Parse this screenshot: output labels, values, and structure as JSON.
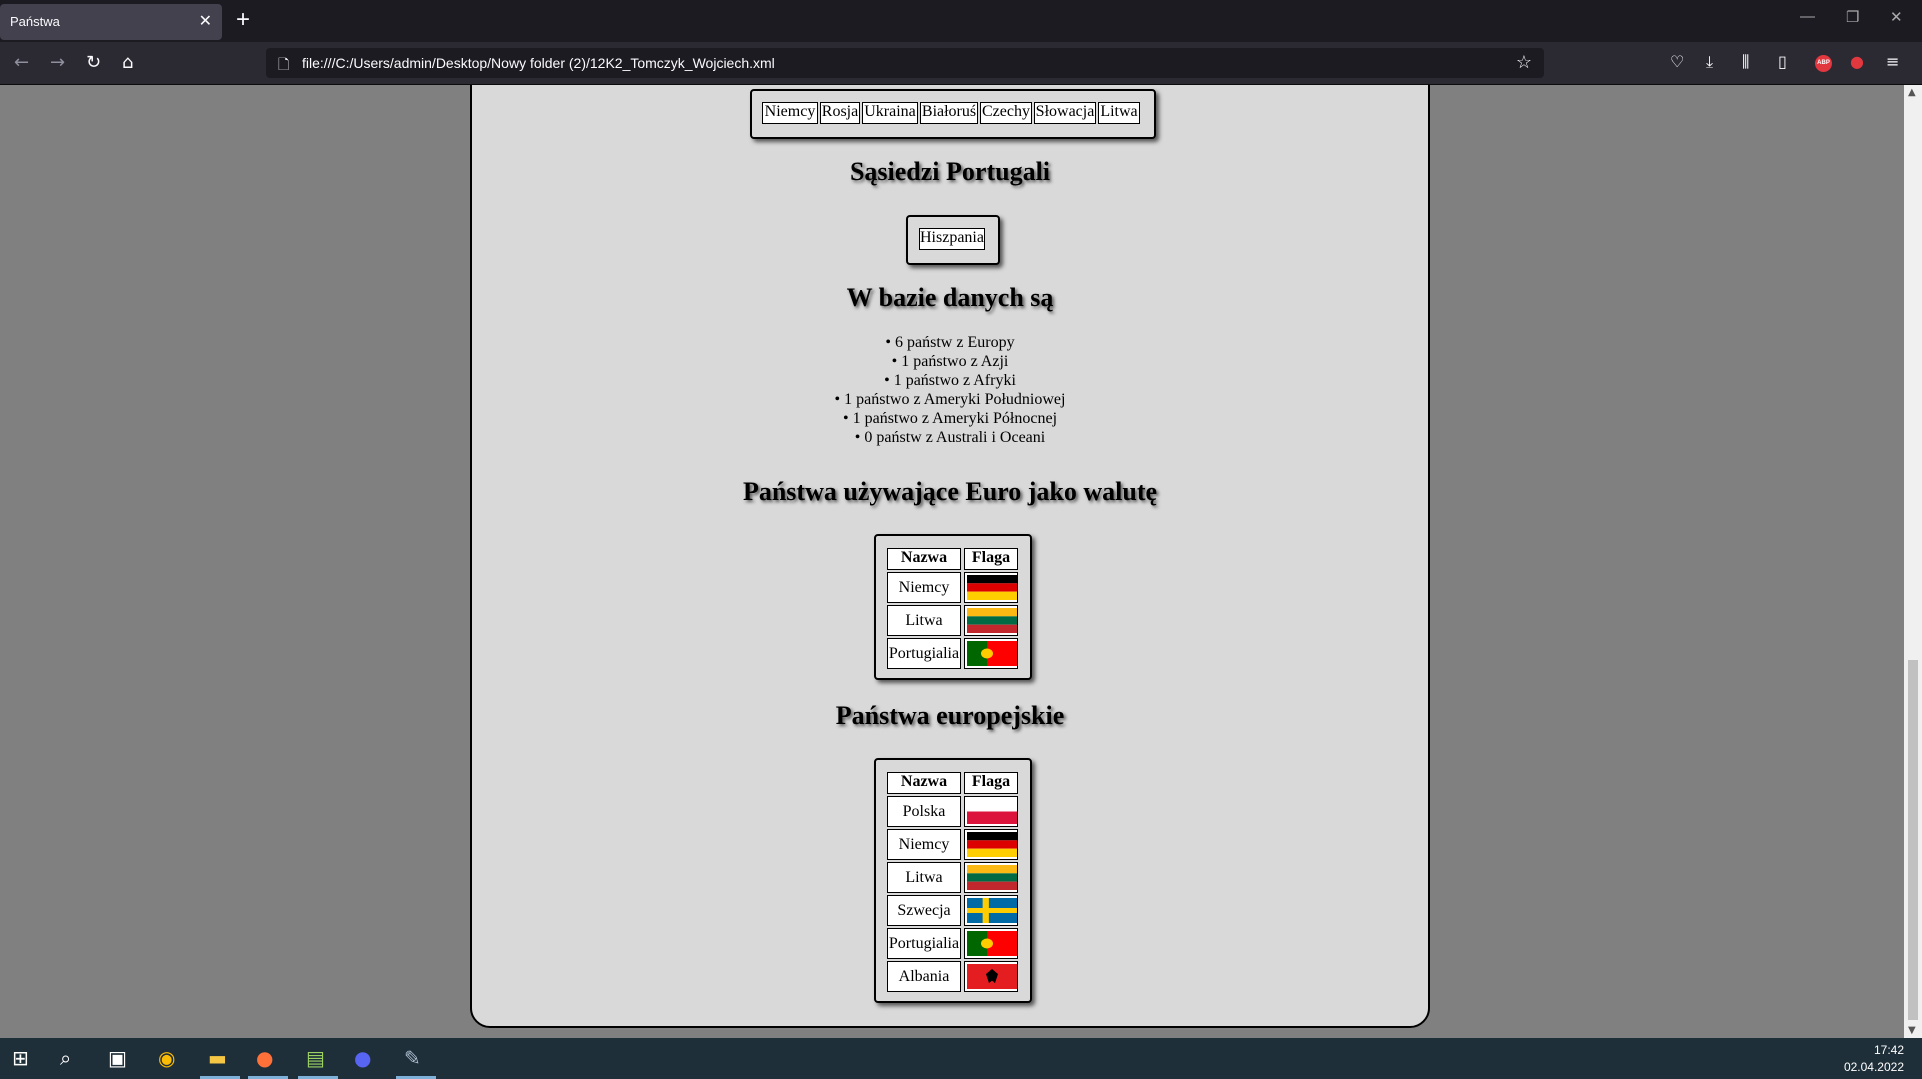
{
  "browser": {
    "tab_title": "Państwa",
    "tab_close": "✕",
    "new_tab": "+",
    "url": "file:///C:/Users/admin/Desktop/Nowy folder (2)/12K2_Tomczyk_Wojciech.xml"
  },
  "page": {
    "neighbors_top": [
      "Niemcy",
      "Rosja",
      "Ukraina",
      "Białoruś",
      "Czechy",
      "Słowacja",
      "Litwa"
    ],
    "portugal_heading": "Sąsiedzi Portugali",
    "portugal_neighbors": [
      "Hiszpania"
    ],
    "db_heading": "W bazie danych są",
    "db_items": [
      "6 państw z Europy",
      "1 państwo z Azji",
      "1 państwo z Afryki",
      "1 państwo z Ameryki Południowej",
      "1 państwo z Ameryki Północnej",
      "0 państw z Australi i Oceani"
    ],
    "euro_heading": "Państwa używające Euro jako walutę",
    "euro_table": {
      "headers": [
        "Nazwa",
        "Flaga"
      ],
      "rows": [
        {
          "name": "Niemcy",
          "flag": "germany-flag"
        },
        {
          "name": "Litwa",
          "flag": "lithuania-flag"
        },
        {
          "name": "Portugialia",
          "flag": "portugal-flag"
        }
      ]
    },
    "europe_heading": "Państwa europejskie",
    "europe_table": {
      "headers": [
        "Nazwa",
        "Flaga"
      ],
      "rows": [
        {
          "name": "Polska",
          "flag": "poland-flag"
        },
        {
          "name": "Niemcy",
          "flag": "germany-flag"
        },
        {
          "name": "Litwa",
          "flag": "lithuania-flag"
        },
        {
          "name": "Szwecja",
          "flag": "sweden-flag"
        },
        {
          "name": "Portugialia",
          "flag": "portugal-flag"
        },
        {
          "name": "Albania",
          "flag": "albania-flag"
        }
      ]
    }
  },
  "taskbar": {
    "time": "17:42",
    "date": "02.04.2022"
  }
}
